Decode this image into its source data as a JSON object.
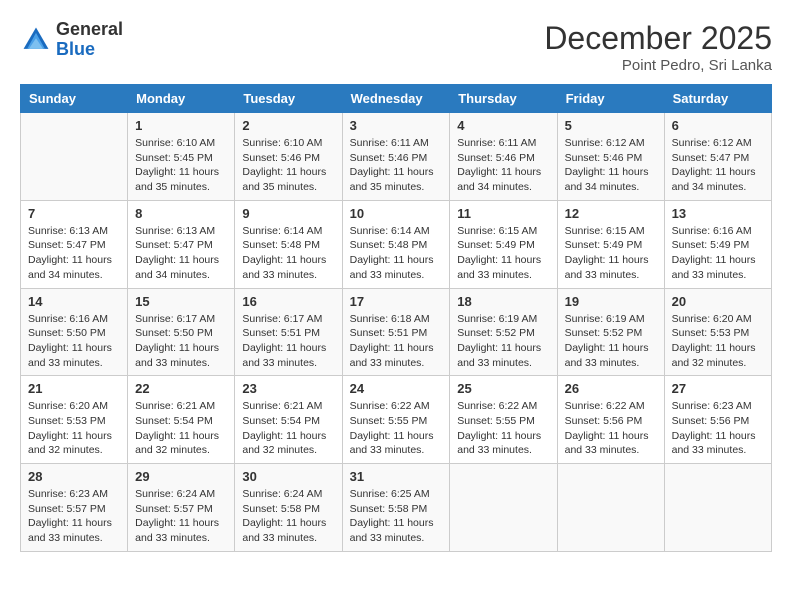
{
  "header": {
    "logo_general": "General",
    "logo_blue": "Blue",
    "month_year": "December 2025",
    "location": "Point Pedro, Sri Lanka"
  },
  "columns": [
    "Sunday",
    "Monday",
    "Tuesday",
    "Wednesday",
    "Thursday",
    "Friday",
    "Saturday"
  ],
  "weeks": [
    [
      {
        "day": "",
        "sunrise": "",
        "sunset": "",
        "daylight": ""
      },
      {
        "day": "1",
        "sunrise": "Sunrise: 6:10 AM",
        "sunset": "Sunset: 5:45 PM",
        "daylight": "Daylight: 11 hours and 35 minutes."
      },
      {
        "day": "2",
        "sunrise": "Sunrise: 6:10 AM",
        "sunset": "Sunset: 5:46 PM",
        "daylight": "Daylight: 11 hours and 35 minutes."
      },
      {
        "day": "3",
        "sunrise": "Sunrise: 6:11 AM",
        "sunset": "Sunset: 5:46 PM",
        "daylight": "Daylight: 11 hours and 35 minutes."
      },
      {
        "day": "4",
        "sunrise": "Sunrise: 6:11 AM",
        "sunset": "Sunset: 5:46 PM",
        "daylight": "Daylight: 11 hours and 34 minutes."
      },
      {
        "day": "5",
        "sunrise": "Sunrise: 6:12 AM",
        "sunset": "Sunset: 5:46 PM",
        "daylight": "Daylight: 11 hours and 34 minutes."
      },
      {
        "day": "6",
        "sunrise": "Sunrise: 6:12 AM",
        "sunset": "Sunset: 5:47 PM",
        "daylight": "Daylight: 11 hours and 34 minutes."
      }
    ],
    [
      {
        "day": "7",
        "sunrise": "Sunrise: 6:13 AM",
        "sunset": "Sunset: 5:47 PM",
        "daylight": "Daylight: 11 hours and 34 minutes."
      },
      {
        "day": "8",
        "sunrise": "Sunrise: 6:13 AM",
        "sunset": "Sunset: 5:47 PM",
        "daylight": "Daylight: 11 hours and 34 minutes."
      },
      {
        "day": "9",
        "sunrise": "Sunrise: 6:14 AM",
        "sunset": "Sunset: 5:48 PM",
        "daylight": "Daylight: 11 hours and 33 minutes."
      },
      {
        "day": "10",
        "sunrise": "Sunrise: 6:14 AM",
        "sunset": "Sunset: 5:48 PM",
        "daylight": "Daylight: 11 hours and 33 minutes."
      },
      {
        "day": "11",
        "sunrise": "Sunrise: 6:15 AM",
        "sunset": "Sunset: 5:49 PM",
        "daylight": "Daylight: 11 hours and 33 minutes."
      },
      {
        "day": "12",
        "sunrise": "Sunrise: 6:15 AM",
        "sunset": "Sunset: 5:49 PM",
        "daylight": "Daylight: 11 hours and 33 minutes."
      },
      {
        "day": "13",
        "sunrise": "Sunrise: 6:16 AM",
        "sunset": "Sunset: 5:49 PM",
        "daylight": "Daylight: 11 hours and 33 minutes."
      }
    ],
    [
      {
        "day": "14",
        "sunrise": "Sunrise: 6:16 AM",
        "sunset": "Sunset: 5:50 PM",
        "daylight": "Daylight: 11 hours and 33 minutes."
      },
      {
        "day": "15",
        "sunrise": "Sunrise: 6:17 AM",
        "sunset": "Sunset: 5:50 PM",
        "daylight": "Daylight: 11 hours and 33 minutes."
      },
      {
        "day": "16",
        "sunrise": "Sunrise: 6:17 AM",
        "sunset": "Sunset: 5:51 PM",
        "daylight": "Daylight: 11 hours and 33 minutes."
      },
      {
        "day": "17",
        "sunrise": "Sunrise: 6:18 AM",
        "sunset": "Sunset: 5:51 PM",
        "daylight": "Daylight: 11 hours and 33 minutes."
      },
      {
        "day": "18",
        "sunrise": "Sunrise: 6:19 AM",
        "sunset": "Sunset: 5:52 PM",
        "daylight": "Daylight: 11 hours and 33 minutes."
      },
      {
        "day": "19",
        "sunrise": "Sunrise: 6:19 AM",
        "sunset": "Sunset: 5:52 PM",
        "daylight": "Daylight: 11 hours and 33 minutes."
      },
      {
        "day": "20",
        "sunrise": "Sunrise: 6:20 AM",
        "sunset": "Sunset: 5:53 PM",
        "daylight": "Daylight: 11 hours and 32 minutes."
      }
    ],
    [
      {
        "day": "21",
        "sunrise": "Sunrise: 6:20 AM",
        "sunset": "Sunset: 5:53 PM",
        "daylight": "Daylight: 11 hours and 32 minutes."
      },
      {
        "day": "22",
        "sunrise": "Sunrise: 6:21 AM",
        "sunset": "Sunset: 5:54 PM",
        "daylight": "Daylight: 11 hours and 32 minutes."
      },
      {
        "day": "23",
        "sunrise": "Sunrise: 6:21 AM",
        "sunset": "Sunset: 5:54 PM",
        "daylight": "Daylight: 11 hours and 32 minutes."
      },
      {
        "day": "24",
        "sunrise": "Sunrise: 6:22 AM",
        "sunset": "Sunset: 5:55 PM",
        "daylight": "Daylight: 11 hours and 33 minutes."
      },
      {
        "day": "25",
        "sunrise": "Sunrise: 6:22 AM",
        "sunset": "Sunset: 5:55 PM",
        "daylight": "Daylight: 11 hours and 33 minutes."
      },
      {
        "day": "26",
        "sunrise": "Sunrise: 6:22 AM",
        "sunset": "Sunset: 5:56 PM",
        "daylight": "Daylight: 11 hours and 33 minutes."
      },
      {
        "day": "27",
        "sunrise": "Sunrise: 6:23 AM",
        "sunset": "Sunset: 5:56 PM",
        "daylight": "Daylight: 11 hours and 33 minutes."
      }
    ],
    [
      {
        "day": "28",
        "sunrise": "Sunrise: 6:23 AM",
        "sunset": "Sunset: 5:57 PM",
        "daylight": "Daylight: 11 hours and 33 minutes."
      },
      {
        "day": "29",
        "sunrise": "Sunrise: 6:24 AM",
        "sunset": "Sunset: 5:57 PM",
        "daylight": "Daylight: 11 hours and 33 minutes."
      },
      {
        "day": "30",
        "sunrise": "Sunrise: 6:24 AM",
        "sunset": "Sunset: 5:58 PM",
        "daylight": "Daylight: 11 hours and 33 minutes."
      },
      {
        "day": "31",
        "sunrise": "Sunrise: 6:25 AM",
        "sunset": "Sunset: 5:58 PM",
        "daylight": "Daylight: 11 hours and 33 minutes."
      },
      {
        "day": "",
        "sunrise": "",
        "sunset": "",
        "daylight": ""
      },
      {
        "day": "",
        "sunrise": "",
        "sunset": "",
        "daylight": ""
      },
      {
        "day": "",
        "sunrise": "",
        "sunset": "",
        "daylight": ""
      }
    ]
  ]
}
